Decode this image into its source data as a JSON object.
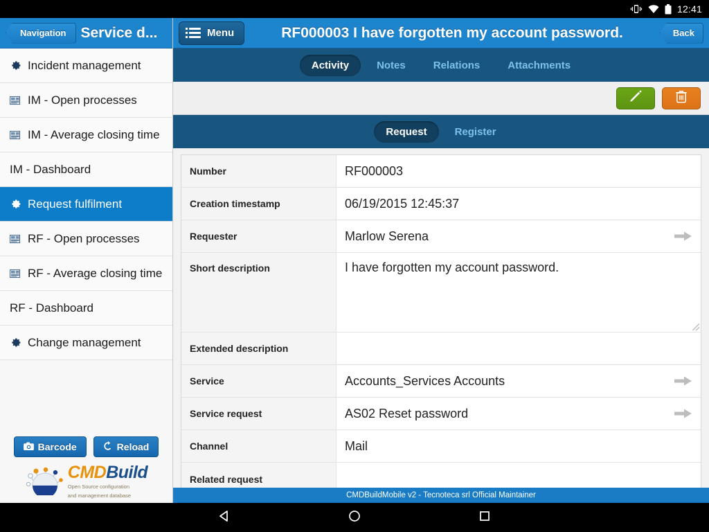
{
  "statusbar": {
    "time": "12:41",
    "icons": [
      "vibrate-icon",
      "wifi-icon",
      "battery-icon"
    ]
  },
  "left_panel": {
    "nav_button": "Navigation",
    "title": "Service d...",
    "menu_items": [
      {
        "label": "Incident management",
        "icon": "gear-icon",
        "active": false
      },
      {
        "label": "IM - Open processes",
        "icon": "report-icon",
        "active": false
      },
      {
        "label": "IM - Average closing time",
        "icon": "report-icon",
        "active": false
      },
      {
        "label": "IM - Dashboard",
        "icon": "none",
        "active": false
      },
      {
        "label": "Request fulfilment",
        "icon": "gear-icon",
        "active": true
      },
      {
        "label": "RF - Open processes",
        "icon": "report-icon",
        "active": false
      },
      {
        "label": "RF - Average closing time",
        "icon": "report-icon",
        "active": false
      },
      {
        "label": "RF - Dashboard",
        "icon": "none",
        "active": false
      },
      {
        "label": "Change management",
        "icon": "gear-icon",
        "active": false
      }
    ],
    "barcode_button": "Barcode",
    "reload_button": "Reload",
    "logo": {
      "cmd": "CMD",
      "build": "Build",
      "tagline_line1": "Open Source configuration",
      "tagline_line2": "and management database"
    }
  },
  "top_bar": {
    "menu_button": "Menu",
    "title": "RF000003 I have forgotten my account password.",
    "back_button": "Back"
  },
  "tabs": [
    {
      "label": "Activity",
      "active": true
    },
    {
      "label": "Notes",
      "active": false
    },
    {
      "label": "Relations",
      "active": false
    },
    {
      "label": "Attachments",
      "active": false
    }
  ],
  "toolbar": {
    "edit_button": "edit-pencil-icon",
    "delete_button": "trash-icon"
  },
  "sub_tabs": [
    {
      "label": "Request",
      "active": true
    },
    {
      "label": "Register",
      "active": false
    }
  ],
  "form_rows": [
    {
      "label": "Number",
      "value": "RF000003",
      "arrow": false,
      "tall": false
    },
    {
      "label": "Creation timestamp",
      "value": "06/19/2015 12:45:37",
      "arrow": false,
      "tall": false
    },
    {
      "label": "Requester",
      "value": "Marlow Serena",
      "arrow": true,
      "tall": false
    },
    {
      "label": "Short description",
      "value": "I have forgotten my account password.",
      "arrow": false,
      "tall": true
    },
    {
      "label": "Extended description",
      "value": "",
      "arrow": false,
      "tall": false
    },
    {
      "label": "Service",
      "value": "Accounts_Services Accounts",
      "arrow": true,
      "tall": false
    },
    {
      "label": "Service request",
      "value": "AS02 Reset password",
      "arrow": true,
      "tall": false
    },
    {
      "label": "Channel",
      "value": "Mail",
      "arrow": false,
      "tall": false
    },
    {
      "label": "Related request",
      "value": "",
      "arrow": false,
      "tall": false
    }
  ],
  "footer": {
    "text": "CMDBuildMobile v2 - Tecnoteca srl Official Maintainer"
  },
  "navbar": {
    "back": "back-triangle-icon",
    "home": "home-circle-icon",
    "recents": "recents-square-icon"
  },
  "colors": {
    "header_blue": "#1d84ce",
    "tab_blue": "#18557f",
    "active_tab": "#123f5e",
    "sidebar_active": "#0d7dc9",
    "edit_green": "#6aa516",
    "delete_orange": "#e8801f"
  }
}
